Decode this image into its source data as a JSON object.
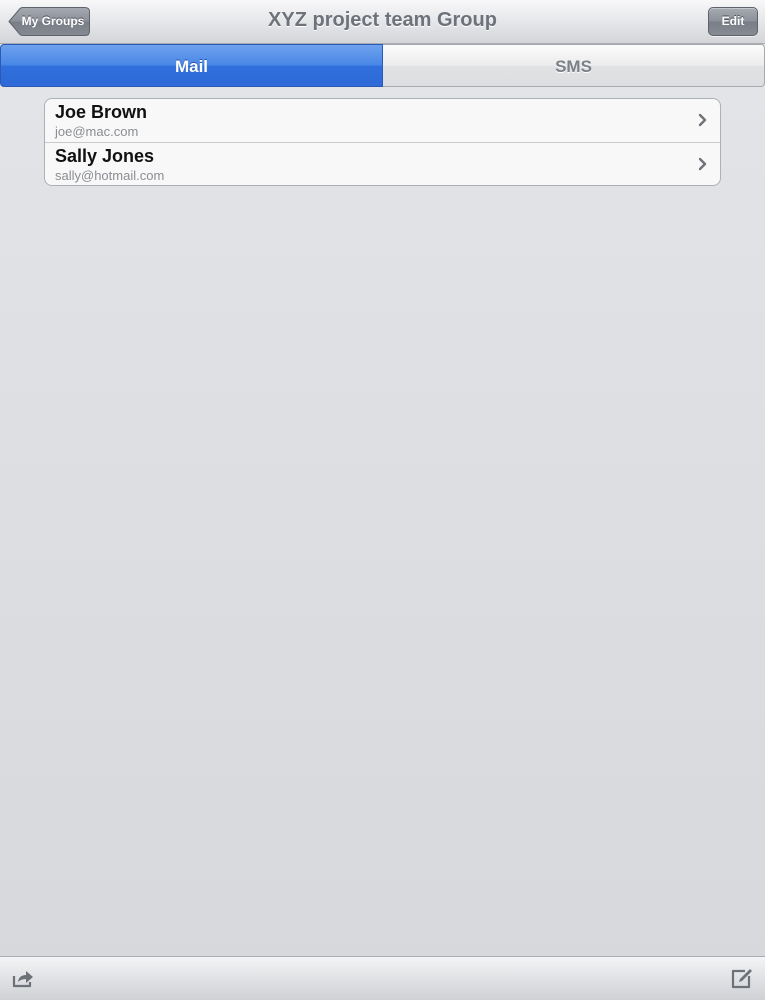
{
  "navbar": {
    "back_label": "My Groups",
    "title": "XYZ project team Group",
    "edit_label": "Edit"
  },
  "segments": [
    {
      "label": "Mail",
      "selected": true
    },
    {
      "label": "SMS",
      "selected": false
    }
  ],
  "contacts": [
    {
      "name": "Joe Brown",
      "email": "joe@mac.com"
    },
    {
      "name": "Sally Jones",
      "email": "sally@hotmail.com"
    }
  ],
  "toolbar": {
    "left_icon": "share-icon",
    "right_icon": "compose-icon"
  },
  "colors": {
    "accent": "#3b7de3",
    "nav_title": "#6e737b"
  }
}
